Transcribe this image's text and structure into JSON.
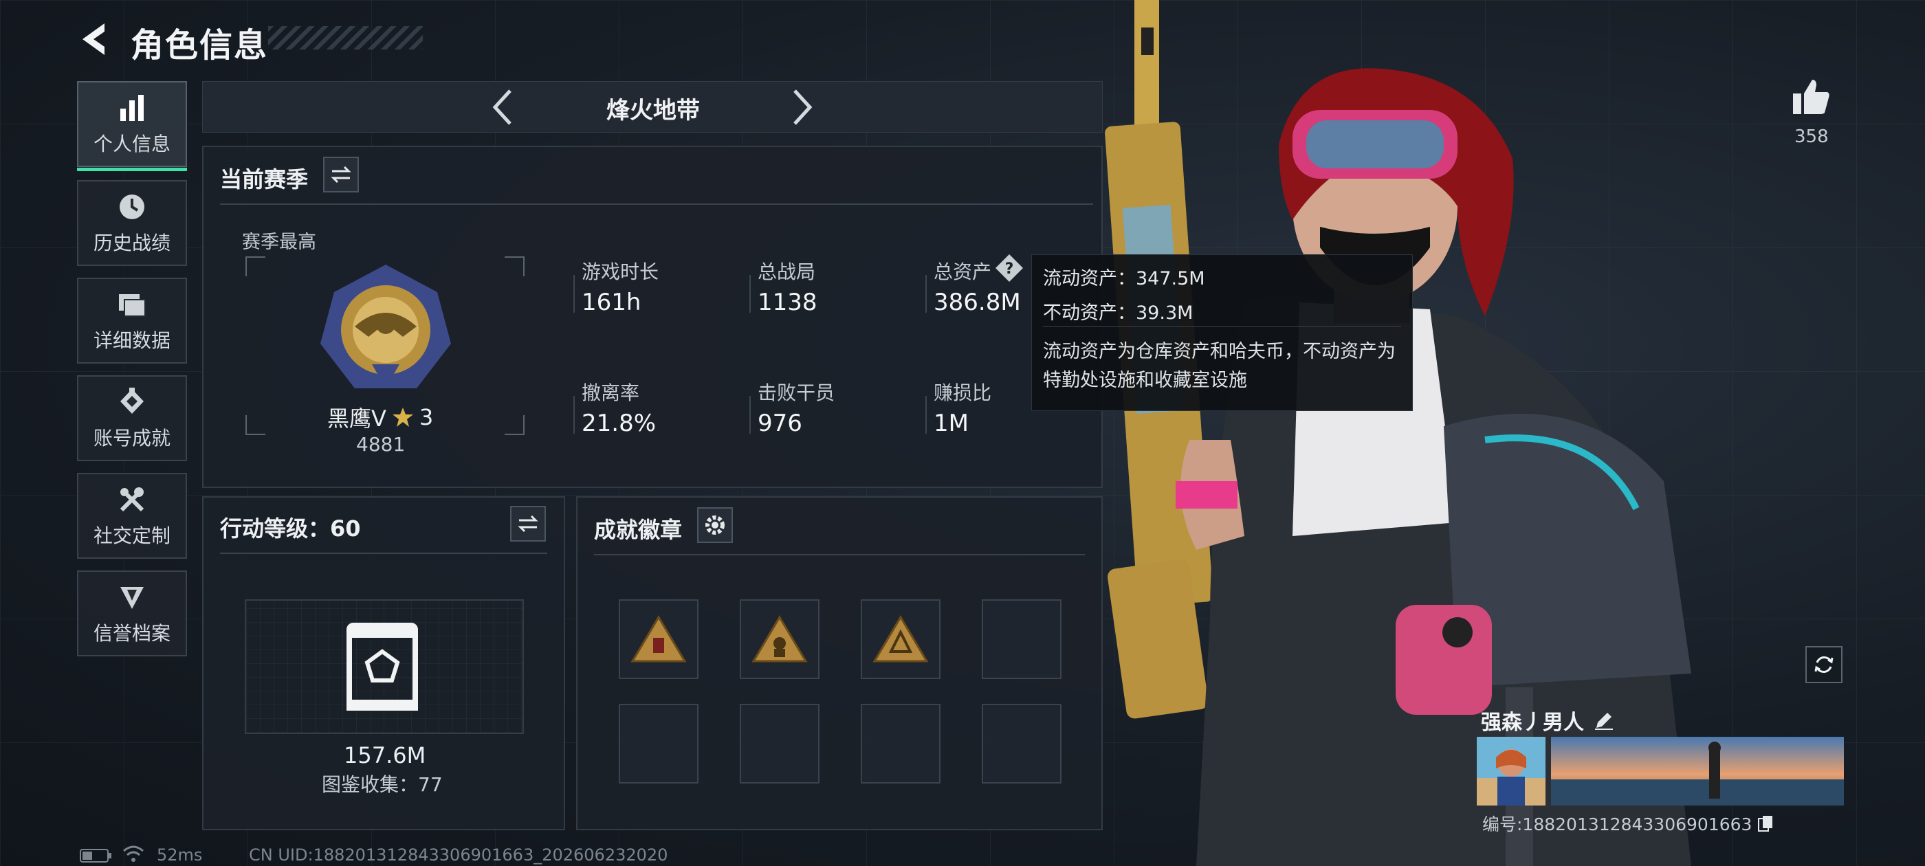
{
  "header": {
    "title": "角色信息"
  },
  "nav": {
    "items": [
      {
        "label": "个人信息",
        "icon": "bar-chart-icon",
        "active": true
      },
      {
        "label": "历史战绩",
        "icon": "clock-icon"
      },
      {
        "label": "详细数据",
        "icon": "folders-icon"
      },
      {
        "label": "账号成就",
        "icon": "achievement-icon"
      },
      {
        "label": "社交定制",
        "icon": "tools-icon"
      },
      {
        "label": "信誉档案",
        "icon": "shield-badge-icon"
      }
    ]
  },
  "mode": {
    "title": "烽火地带"
  },
  "season": {
    "title": "当前赛季",
    "best_label": "赛季最高",
    "rank_name": "黑鹰V",
    "rank_stars": "3",
    "rank_score": "4881",
    "stats": [
      {
        "label": "游戏时长",
        "value": "161h"
      },
      {
        "label": "总战局",
        "value": "1138"
      },
      {
        "label": "总资产",
        "value": "386.8M"
      },
      {
        "label": "撤离率",
        "value": "21.8%"
      },
      {
        "label": "击败干员",
        "value": "976"
      },
      {
        "label": "赚损比",
        "value": "1M"
      }
    ]
  },
  "tooltip": {
    "liquid": "流动资产：347.5M",
    "fixed": "不动资产：39.3M",
    "description": "流动资产为仓库资产和哈夫币，不动资产为特勤处设施和收藏室设施"
  },
  "action_level": {
    "title": "行动等级：60",
    "value": "157.6M",
    "collection": "图鉴收集：77"
  },
  "badges": {
    "title": "成就徽章"
  },
  "likes": {
    "count": "358"
  },
  "profile": {
    "name": "强森丿男人",
    "id_text": "编号:18820131284330690​1663"
  },
  "status": {
    "ping": "52ms",
    "uid": "CN UID:18820131284330690​1663_202606232020"
  },
  "colors": {
    "accent": "#3fe0a8",
    "gold": "#c9a24a"
  }
}
